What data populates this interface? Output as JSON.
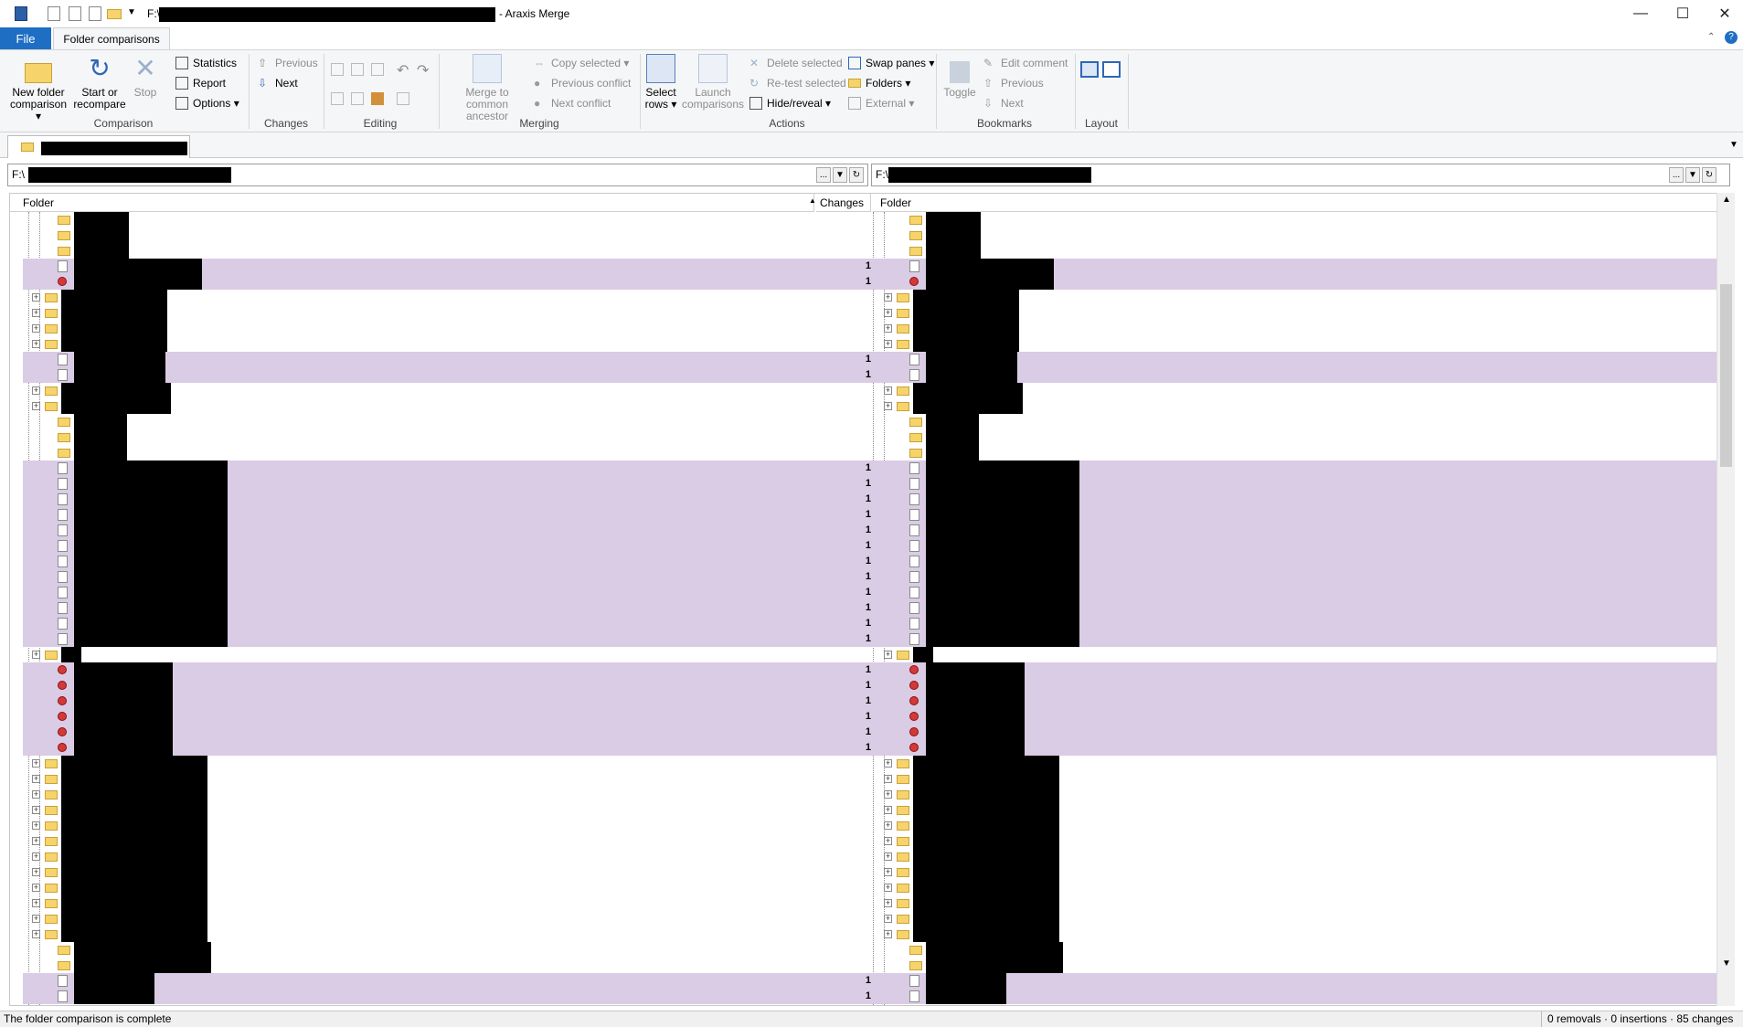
{
  "window": {
    "path_prefix": "F:\\",
    "title_suffix": "- Araxis Merge"
  },
  "ribbon_tabs": {
    "file": "File",
    "folder_comparisons": "Folder comparisons"
  },
  "ribbon": {
    "comparison": {
      "label": "Comparison",
      "new_folder_comparison": "New folder comparison",
      "start_or_recompare": "Start or recompare",
      "stop": "Stop",
      "statistics": "Statistics",
      "report": "Report",
      "options": "Options"
    },
    "changes": {
      "label": "Changes",
      "previous": "Previous",
      "next": "Next"
    },
    "editing": {
      "label": "Editing"
    },
    "merging": {
      "label": "Merging",
      "merge_to_common_ancestor": "Merge to common ancestor",
      "copy_selected": "Copy selected",
      "previous_conflict": "Previous conflict",
      "next_conflict": "Next conflict"
    },
    "actions": {
      "label": "Actions",
      "select_rows": "Select rows",
      "launch_comparisons": "Launch comparisons",
      "delete_selected": "Delete selected",
      "retest_selected": "Re-test selected",
      "hide_reveal": "Hide/reveal",
      "swap_panes": "Swap panes",
      "folders": "Folders",
      "external": "External"
    },
    "bookmarks": {
      "label": "Bookmarks",
      "toggle": "Toggle",
      "edit_comment": "Edit comment",
      "previous": "Previous",
      "next": "Next"
    },
    "layout": {
      "label": "Layout"
    }
  },
  "paths": {
    "left": "F:\\",
    "right": "F:\\",
    "browse": "..."
  },
  "columns": {
    "left_folder": "Folder",
    "changes": "Changes",
    "right_folder": "Folder"
  },
  "change_count": "1",
  "status": {
    "message": "The folder comparison is complete",
    "summary": "0 removals · 0 insertions · 85 changes"
  }
}
